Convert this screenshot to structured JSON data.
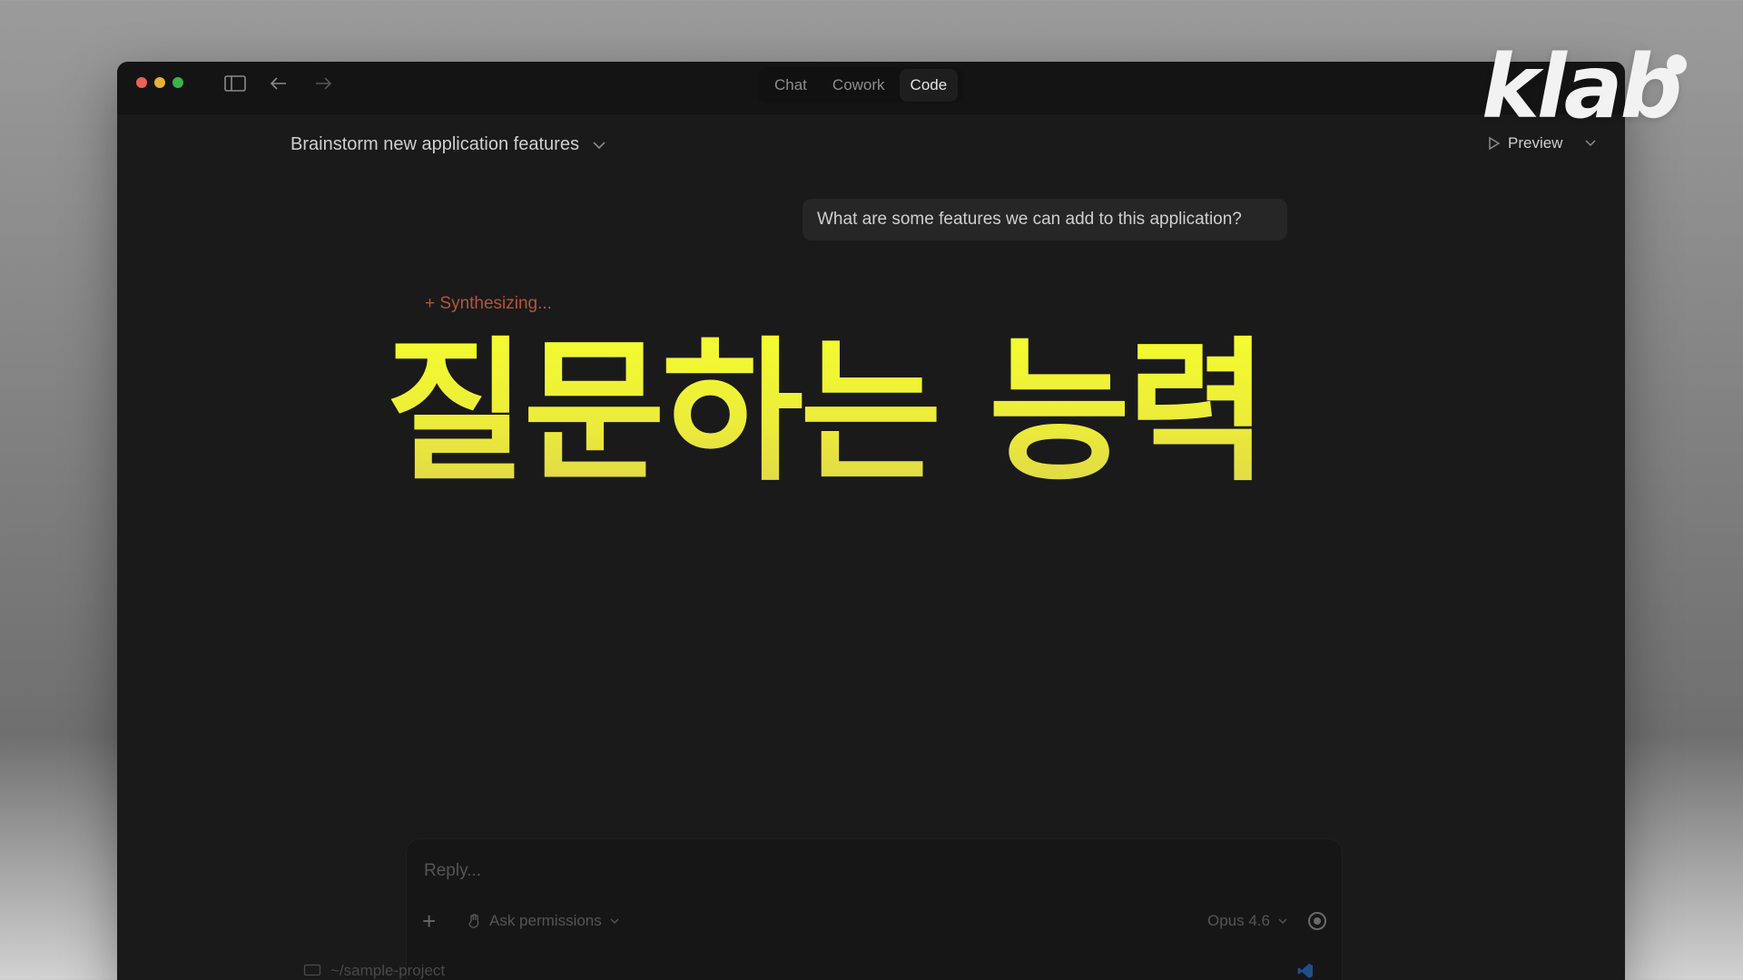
{
  "window": {
    "tabs": [
      {
        "label": "Chat",
        "active": false
      },
      {
        "label": "Cowork",
        "active": false
      },
      {
        "label": "Code",
        "active": true
      }
    ],
    "icons": [
      "sidebar-toggle-icon",
      "arrow-left-icon",
      "arrow-right-icon"
    ]
  },
  "session": {
    "title": "Brainstorm new application features"
  },
  "preview": {
    "label": "Preview"
  },
  "conversation": {
    "user_message": "What are some features we can add to this application?",
    "status_icon": "+",
    "status_text": "Synthesizing..."
  },
  "overlay": {
    "headline": "질문하는 능력",
    "headline_color": "#f0f23a",
    "logo": "klab"
  },
  "composer": {
    "placeholder": "Reply...",
    "permissions_label": "Ask permissions",
    "model_label": "Opus 4.6",
    "project_path": "~/sample-project"
  },
  "colors": {
    "window_bg": "#1a1a1a",
    "titlebar_bg": "#141414",
    "status_accent": "#b4553c",
    "traffic_red": "#ed5f58",
    "traffic_yellow": "#e7b233",
    "traffic_green": "#39b446"
  }
}
